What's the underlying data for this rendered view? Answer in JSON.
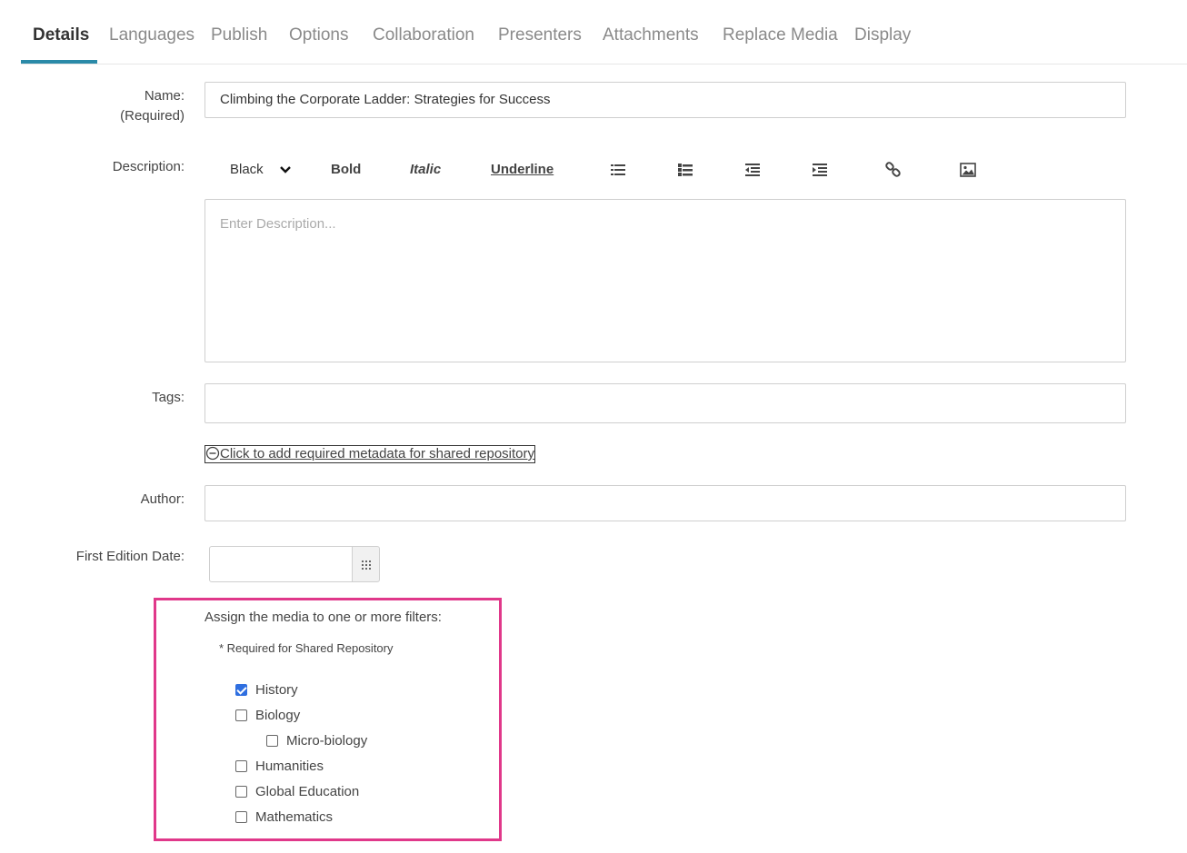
{
  "tabs": [
    "Details",
    "Languages",
    "Publish",
    "Options",
    "Collaboration",
    "Presenters",
    "Attachments",
    "Replace Media",
    "Display"
  ],
  "form": {
    "name_label": "Name:",
    "name_required": "(Required)",
    "name_value": "Climbing the Corporate Ladder: Strategies for Success",
    "description_label": "Description:",
    "description_placeholder": "Enter Description...",
    "tags_label": "Tags:",
    "metadata_link": "Click to add required metadata for shared repository",
    "author_label": "Author:",
    "first_edition_label": "First Edition Date:"
  },
  "toolbar": {
    "color_select": "Black",
    "bold": "Bold",
    "italic": "Italic",
    "underline": "Underline",
    "icons": [
      "ordered-list-icon",
      "unordered-list-icon",
      "outdent-icon",
      "indent-icon",
      "link-icon",
      "image-icon"
    ]
  },
  "filters": {
    "title": "Assign the media to one or more filters:",
    "note": "* Required for Shared Repository",
    "items": [
      {
        "label": "History",
        "checked": true,
        "level": 0
      },
      {
        "label": "Biology",
        "checked": false,
        "level": 0
      },
      {
        "label": "Micro-biology",
        "checked": false,
        "level": 1
      },
      {
        "label": "Humanities",
        "checked": false,
        "level": 0
      },
      {
        "label": "Global Education",
        "checked": false,
        "level": 0
      },
      {
        "label": "Mathematics",
        "checked": false,
        "level": 0
      }
    ]
  },
  "colors": {
    "active_tab_underline": "#2a8aa8",
    "filter_box_border": "#e0388a",
    "checkbox_checked": "#2f6fe0"
  }
}
